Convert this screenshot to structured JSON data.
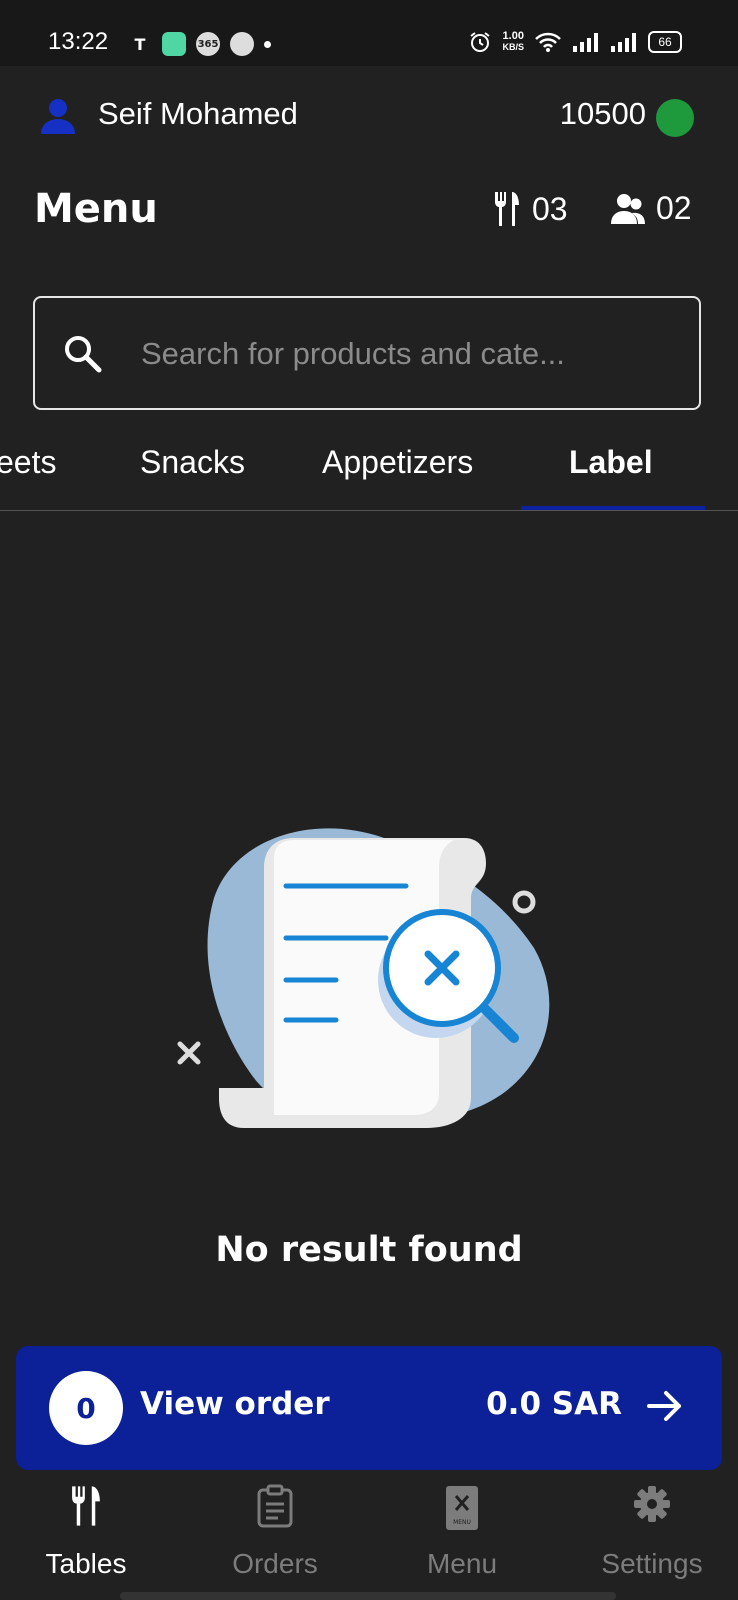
{
  "status_bar": {
    "time": "13:22",
    "net_speed_value": "1.00",
    "net_speed_unit": "KB/S",
    "battery": "66",
    "app_icon_365": "365"
  },
  "header": {
    "user_name": "Seif Mohamed",
    "balance": "10500",
    "status_color": "#1e9a3c"
  },
  "page": {
    "title": "Menu",
    "tables_count": "03",
    "guests_count": "02"
  },
  "search": {
    "placeholder": "Search for products and cate..."
  },
  "tabs": [
    {
      "label": "eets",
      "active": false
    },
    {
      "label": "Snacks",
      "active": false
    },
    {
      "label": "Appetizers",
      "active": false
    },
    {
      "label": "Label",
      "active": true
    }
  ],
  "empty_state": {
    "message": "No result found"
  },
  "order_bar": {
    "count": "0",
    "label": "View order",
    "total": "0.0 SAR"
  },
  "bottom_nav": [
    {
      "label": "Tables",
      "icon": "fork-knife-icon",
      "active": true
    },
    {
      "label": "Orders",
      "icon": "clipboard-icon",
      "active": false
    },
    {
      "label": "Menu",
      "icon": "menu-book-icon",
      "active": false
    },
    {
      "label": "Settings",
      "icon": "gear-icon",
      "active": false
    }
  ],
  "menu_icon_caption": "MENU",
  "colors": {
    "background": "#212121",
    "accent": "#0c2097",
    "tab_underline": "#0c22a0",
    "online": "#1e9a3c"
  }
}
